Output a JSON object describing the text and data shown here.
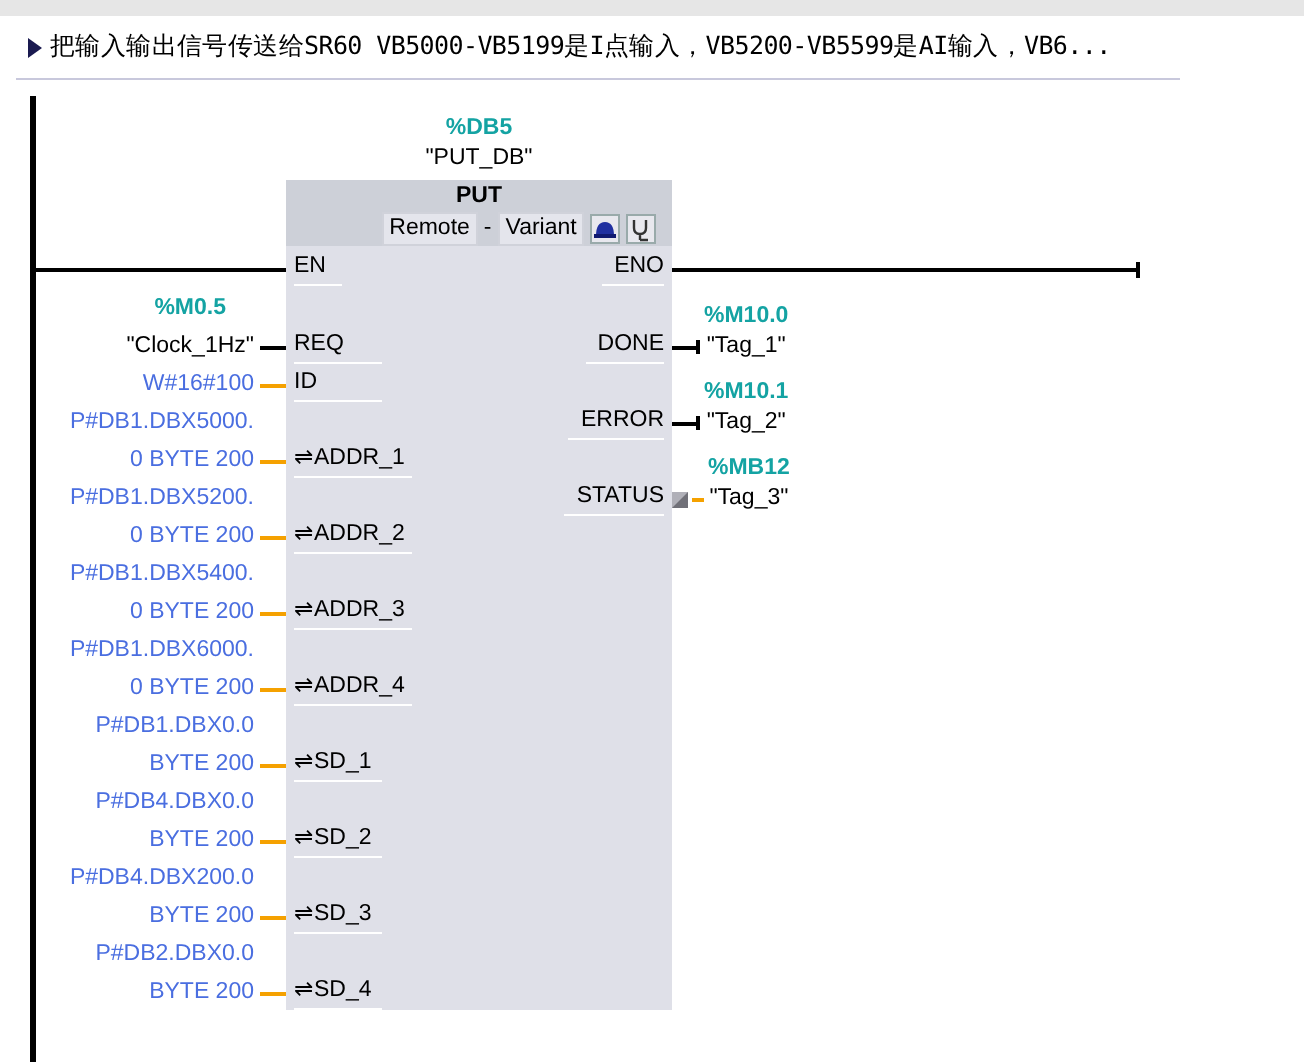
{
  "comment": {
    "expanded": false,
    "text": "把输入输出信号传送给SR60 VB5000-VB5199是I点输入，VB5200-VB5599是AI输入，VB6..."
  },
  "block": {
    "instance_address": "%DB5",
    "instance_name": "\"PUT_DB\"",
    "title": "PUT",
    "option_1": "Remote",
    "separator": "-",
    "option_2": "Variant",
    "en": "EN",
    "eno": "ENO",
    "inputs": [
      {
        "kind": "bool",
        "address": "%M0.5",
        "lines": [
          "\"Clock_1Hz\""
        ],
        "pin": "REQ"
      },
      {
        "kind": "constant",
        "lines": [
          "W#16#100"
        ],
        "pin": "ID"
      },
      {
        "kind": "pointer",
        "lines": [
          "P#DB1.DBX5000.",
          "0 BYTE 200"
        ],
        "pin": "⇌ADDR_1"
      },
      {
        "kind": "pointer",
        "lines": [
          "P#DB1.DBX5200.",
          "0 BYTE 200"
        ],
        "pin": "⇌ADDR_2"
      },
      {
        "kind": "pointer",
        "lines": [
          "P#DB1.DBX5400.",
          "0 BYTE 200"
        ],
        "pin": "⇌ADDR_3"
      },
      {
        "kind": "pointer",
        "lines": [
          "P#DB1.DBX6000.",
          "0 BYTE 200"
        ],
        "pin": "⇌ADDR_4"
      },
      {
        "kind": "pointer",
        "lines": [
          "P#DB1.DBX0.0",
          "BYTE 200"
        ],
        "pin": "⇌SD_1"
      },
      {
        "kind": "pointer",
        "lines": [
          "P#DB4.DBX0.0",
          "BYTE 200"
        ],
        "pin": "⇌SD_2"
      },
      {
        "kind": "pointer",
        "lines": [
          "P#DB4.DBX200.0",
          "BYTE 200"
        ],
        "pin": "⇌SD_3"
      },
      {
        "kind": "pointer",
        "lines": [
          "P#DB2.DBX0.0",
          "BYTE 200"
        ],
        "pin": "⇌SD_4"
      }
    ],
    "outputs": [
      {
        "kind": "bool",
        "address": "%M10.0",
        "value": "\"Tag_1\"",
        "pin": "DONE"
      },
      {
        "kind": "bool",
        "address": "%M10.1",
        "value": "\"Tag_2\"",
        "pin": "ERROR"
      },
      {
        "kind": "word",
        "address": "%MB12",
        "value": "\"Tag_3\"",
        "pin": "STATUS"
      }
    ]
  }
}
